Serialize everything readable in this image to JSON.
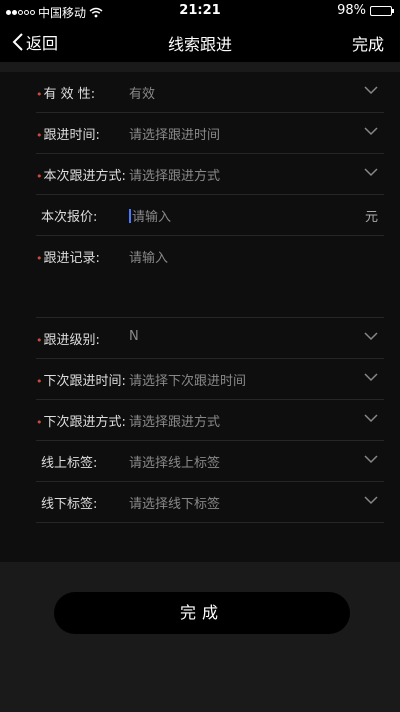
{
  "status_bar": {
    "carrier": "中国移动",
    "time": "21:21",
    "battery": "98%",
    "battery_level": 0.98
  },
  "nav": {
    "back_label": "返回",
    "title": "线索跟进",
    "done_label": "完成"
  },
  "form": {
    "validity": {
      "label": "有 效 性:",
      "value": "有效",
      "required": true
    },
    "followup_time": {
      "label": "跟进时间:",
      "placeholder": "请选择跟进时间",
      "required": true
    },
    "followup_method": {
      "label": "本次跟进方式:",
      "placeholder": "请选择跟进方式",
      "required": true
    },
    "quote": {
      "label": "本次报价:",
      "placeholder": "请输入",
      "unit": "元",
      "required": false
    },
    "record": {
      "label": "跟进记录:",
      "placeholder": "请输入",
      "required": true
    },
    "followup_level": {
      "label": "跟进级别:",
      "value": "N",
      "required": true
    },
    "next_followup_time": {
      "label": "下次跟进时间:",
      "placeholder": "请选择下次跟进时间",
      "required": true
    },
    "next_followup_method": {
      "label": "下次跟进方式:",
      "placeholder": "请选择跟进方式",
      "required": true
    },
    "online_tags": {
      "label": "线上标签:",
      "placeholder": "请选择线上标签",
      "required": false
    },
    "offline_tags": {
      "label": "线下标签:",
      "placeholder": "请选择线下标签",
      "required": false
    }
  },
  "submit": {
    "label": "完成"
  }
}
